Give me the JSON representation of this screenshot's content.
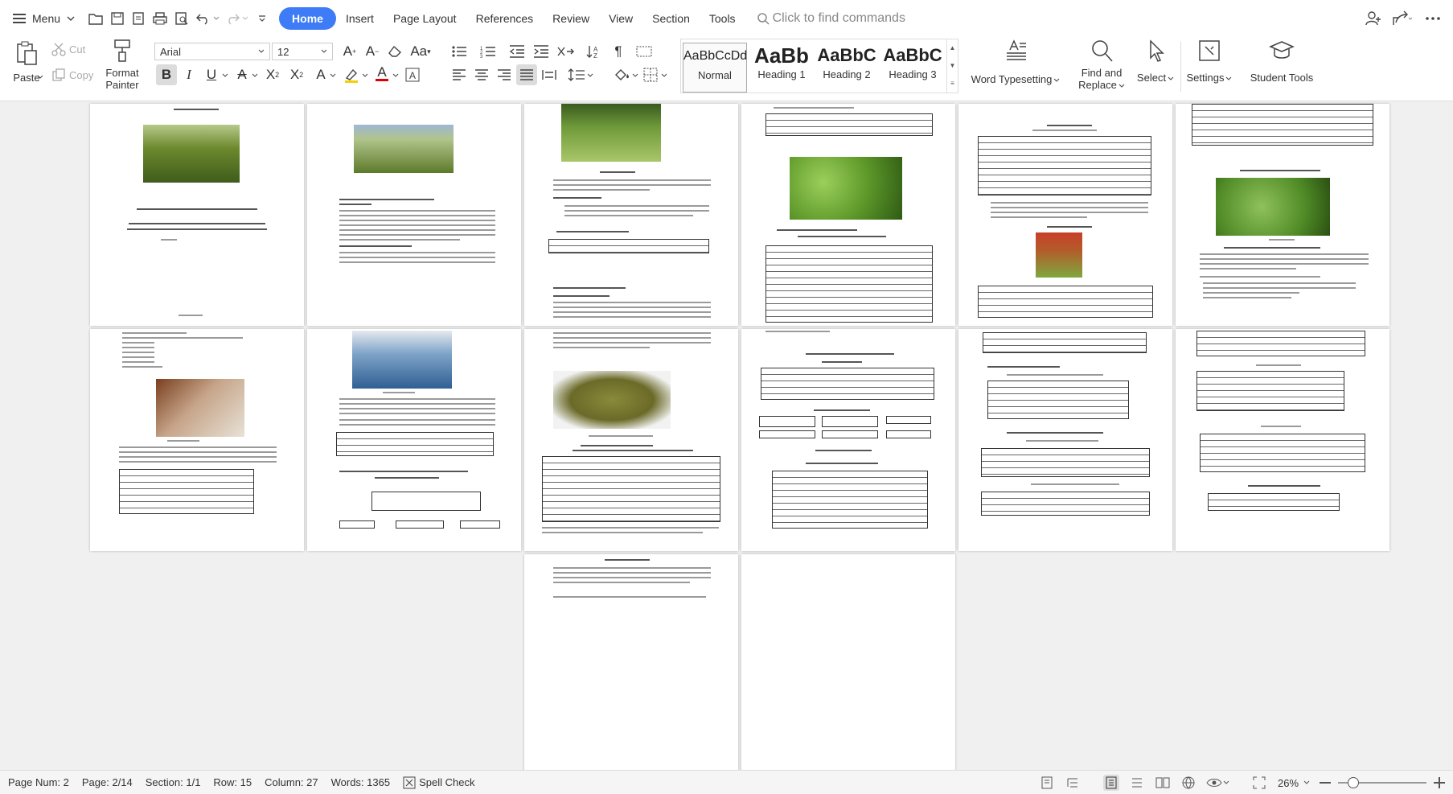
{
  "menubar": {
    "menu_label": "Menu",
    "tabs": [
      {
        "label": "Home",
        "active": true
      },
      {
        "label": "Insert"
      },
      {
        "label": "Page Layout"
      },
      {
        "label": "References"
      },
      {
        "label": "Review"
      },
      {
        "label": "View"
      },
      {
        "label": "Section"
      },
      {
        "label": "Tools"
      }
    ],
    "search_placeholder": "Click to find commands"
  },
  "ribbon": {
    "paste": "Paste",
    "cut": "Cut",
    "copy": "Copy",
    "format_painter_line1": "Format",
    "format_painter_line2": "Painter",
    "font_name": "Arial",
    "font_size": "12",
    "styles": [
      {
        "sample": "AaBbCcDd",
        "name": "Normal"
      },
      {
        "sample": "AaBb",
        "name": "Heading 1"
      },
      {
        "sample": "AaBbC",
        "name": "Heading 2"
      },
      {
        "sample": "AaBbC",
        "name": "Heading 3"
      }
    ],
    "word_typesetting": "Word Typesetting",
    "find_line1": "Find and",
    "find_line2": "Replace",
    "select": "Select",
    "settings": "Settings",
    "student_tools": "Student Tools"
  },
  "status": {
    "page_num": "Page Num: 2",
    "page": "Page: 2/14",
    "section": "Section: 1/1",
    "row": "Row: 15",
    "column": "Column: 27",
    "words": "Words: 1365",
    "spell_check": "Spell Check",
    "zoom": "26%"
  },
  "accent_color": "#3d7cf6"
}
